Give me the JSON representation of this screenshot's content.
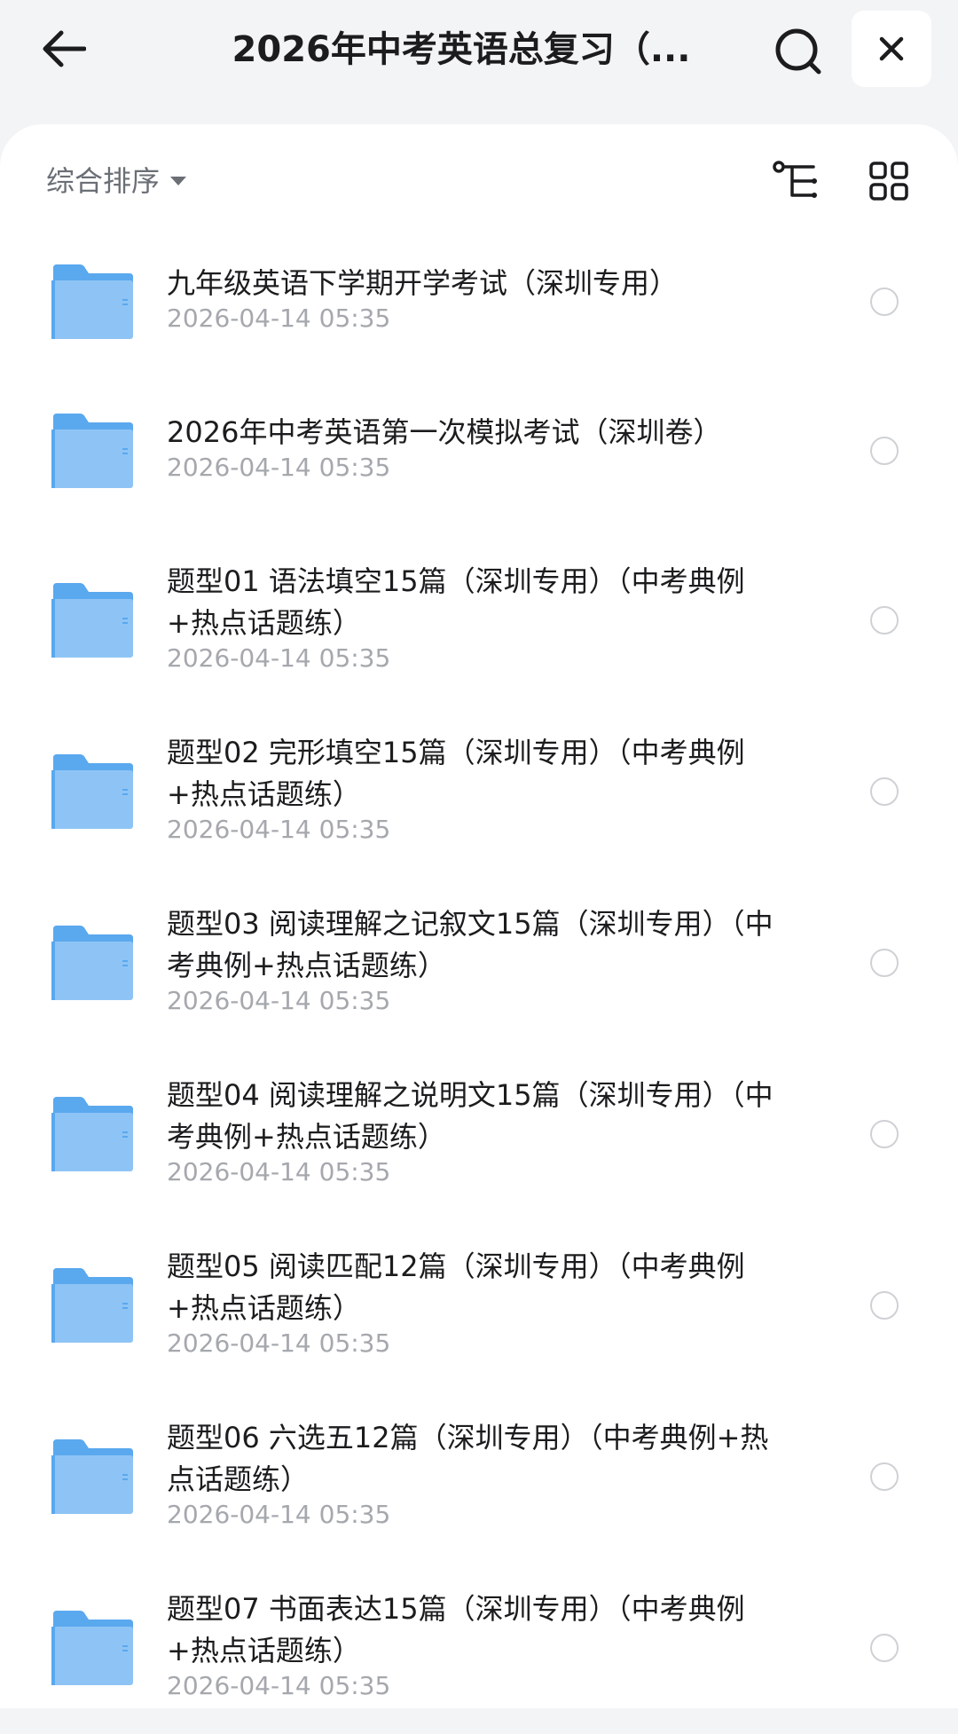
{
  "header": {
    "title": "2026年中考英语总复习（...",
    "back_icon": "arrow-left-icon",
    "search_icon": "search-icon",
    "close_icon": "close-icon"
  },
  "toolbar": {
    "sort_label": "综合排序",
    "sort_icon": "caret-down-icon",
    "tree_view_icon": "tree-view-icon",
    "grid_view_icon": "grid-view-icon"
  },
  "colors": {
    "folder_body": "#8ec4f5",
    "folder_tab": "#5aa8ee",
    "text_primary": "#1c1c1e",
    "text_secondary": "#a5a8ad",
    "page_bg": "#f3f4f6"
  },
  "files": [
    {
      "name": "九年级英语下学期开学考试（深圳专用）",
      "date": "2026-04-14 05:35",
      "icon": "folder-icon"
    },
    {
      "name": "2026年中考英语第一次模拟考试（深圳卷）",
      "date": "2026-04-14 05:35",
      "icon": "folder-icon"
    },
    {
      "name": "题型01 语法填空15篇（深圳专用）（中考典例+热点话题练）",
      "date": "2026-04-14 05:35",
      "icon": "folder-icon"
    },
    {
      "name": "题型02 完形填空15篇（深圳专用）（中考典例+热点话题练）",
      "date": "2026-04-14 05:35",
      "icon": "folder-icon"
    },
    {
      "name": "题型03 阅读理解之记叙文15篇（深圳专用）（中考典例+热点话题练）",
      "date": "2026-04-14 05:35",
      "icon": "folder-icon"
    },
    {
      "name": "题型04 阅读理解之说明文15篇（深圳专用）（中考典例+热点话题练）",
      "date": "2026-04-14 05:35",
      "icon": "folder-icon"
    },
    {
      "name": "题型05 阅读匹配12篇（深圳专用）（中考典例+热点话题练）",
      "date": "2026-04-14 05:35",
      "icon": "folder-icon"
    },
    {
      "name": "题型06 六选五12篇（深圳专用）（中考典例+热点话题练）",
      "date": "2026-04-14 05:35",
      "icon": "folder-icon"
    },
    {
      "name": "题型07 书面表达15篇（深圳专用）（中考典例+热点话题练）",
      "date": "2026-04-14 05:35",
      "icon": "folder-icon"
    }
  ]
}
